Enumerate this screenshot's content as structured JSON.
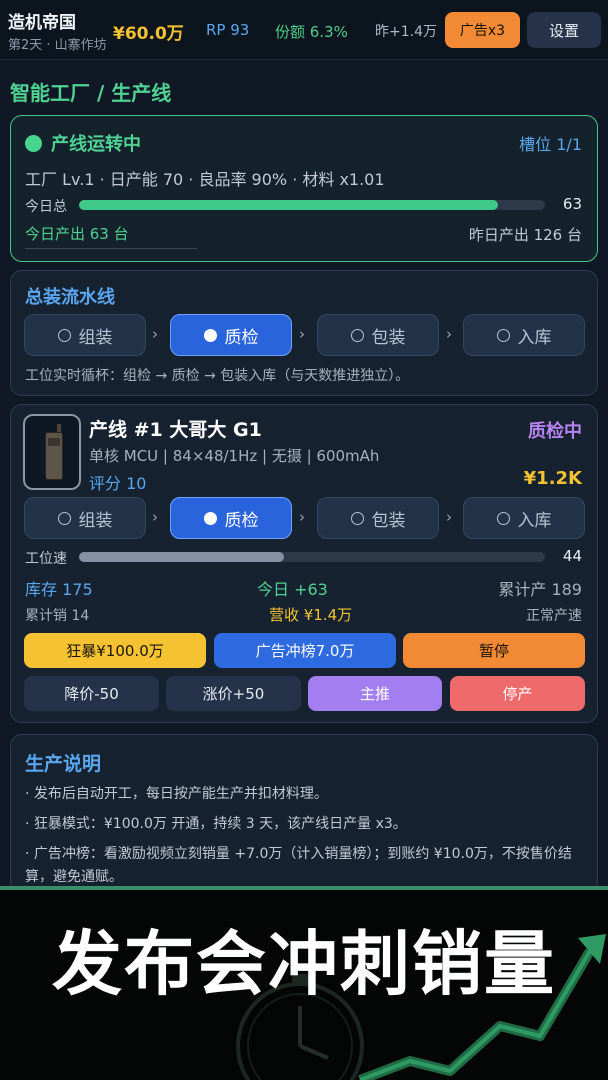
{
  "header": {
    "title": "造机帝国",
    "subtitle": "第2天 · 山寨作坊",
    "money": "¥60.0万",
    "rp": "RP 93",
    "share": "份额 6.3%",
    "yesterday": "昨+1.4万",
    "ad_button": "广告x3",
    "settings_button": "设置"
  },
  "page_title": "智能工厂 / 生产线",
  "status_card": {
    "title": "产线运转中",
    "slot": "槽位 1/1",
    "factory_info": "工厂 Lv.1 · 日产能 70 · 良品率 90% · 材料 x1.01",
    "today_label": "今日总",
    "today_value": "63",
    "today_progress": 0.9,
    "today_output": "今日产出 63 台",
    "yesterday_output": "昨日产出 126 台"
  },
  "flow_card": {
    "title": "总装流水线",
    "stages": [
      "组装",
      "质检",
      "包装",
      "入库"
    ],
    "active_stage": 1,
    "note": "工位实时循杯：组检 → 质检 → 包装入库（与天数推进独立）。"
  },
  "line_card": {
    "name": "产线 #1  大哥大 G1",
    "state": "质检中",
    "spec": "单核 MCU | 84×48/1Hz | 无摄 | 600mAh",
    "score": "评分 10",
    "price": "¥1.2K",
    "stages": [
      "组装",
      "质检",
      "包装",
      "入库"
    ],
    "active_stage": 1,
    "speed_label": "工位速",
    "speed_value": "44",
    "speed_progress": 0.44,
    "stock": "库存 175",
    "today_plus": "今日 +63",
    "cumulative_produced": "累计产 189",
    "cumulative_sold": "累计销 14",
    "revenue": "营收 ¥1.4万",
    "production_state": "正常产速",
    "buttons": {
      "frenzy": "狂暴¥100.0万",
      "ad_push": "广告冲榜7.0万",
      "pause": "暂停",
      "price_down": "降价-50",
      "price_up": "涨价+50",
      "feature": "主推",
      "stop": "停产"
    }
  },
  "info_card": {
    "title": "生产说明",
    "lines": [
      "· 发布后自动开工，每日按产能生产并扣材料理。",
      "· 狂暴模式：¥100.0万 开通，持续 3 天，该产线日产量 x3。",
      "· 广告冲榜：看激励视频立刻销量 +7.0万（计入销量榜）；到账约 ¥10.0万，不按售价结算，避免通赋。"
    ]
  },
  "banner": {
    "text": "发布会冲刺销量"
  },
  "colors": {
    "accent_green": "#46d58f",
    "accent_blue": "#2a64dd",
    "gold": "#f5c232",
    "orange": "#f28a35",
    "purple": "#a37ef0",
    "red": "#ef6a6a"
  }
}
